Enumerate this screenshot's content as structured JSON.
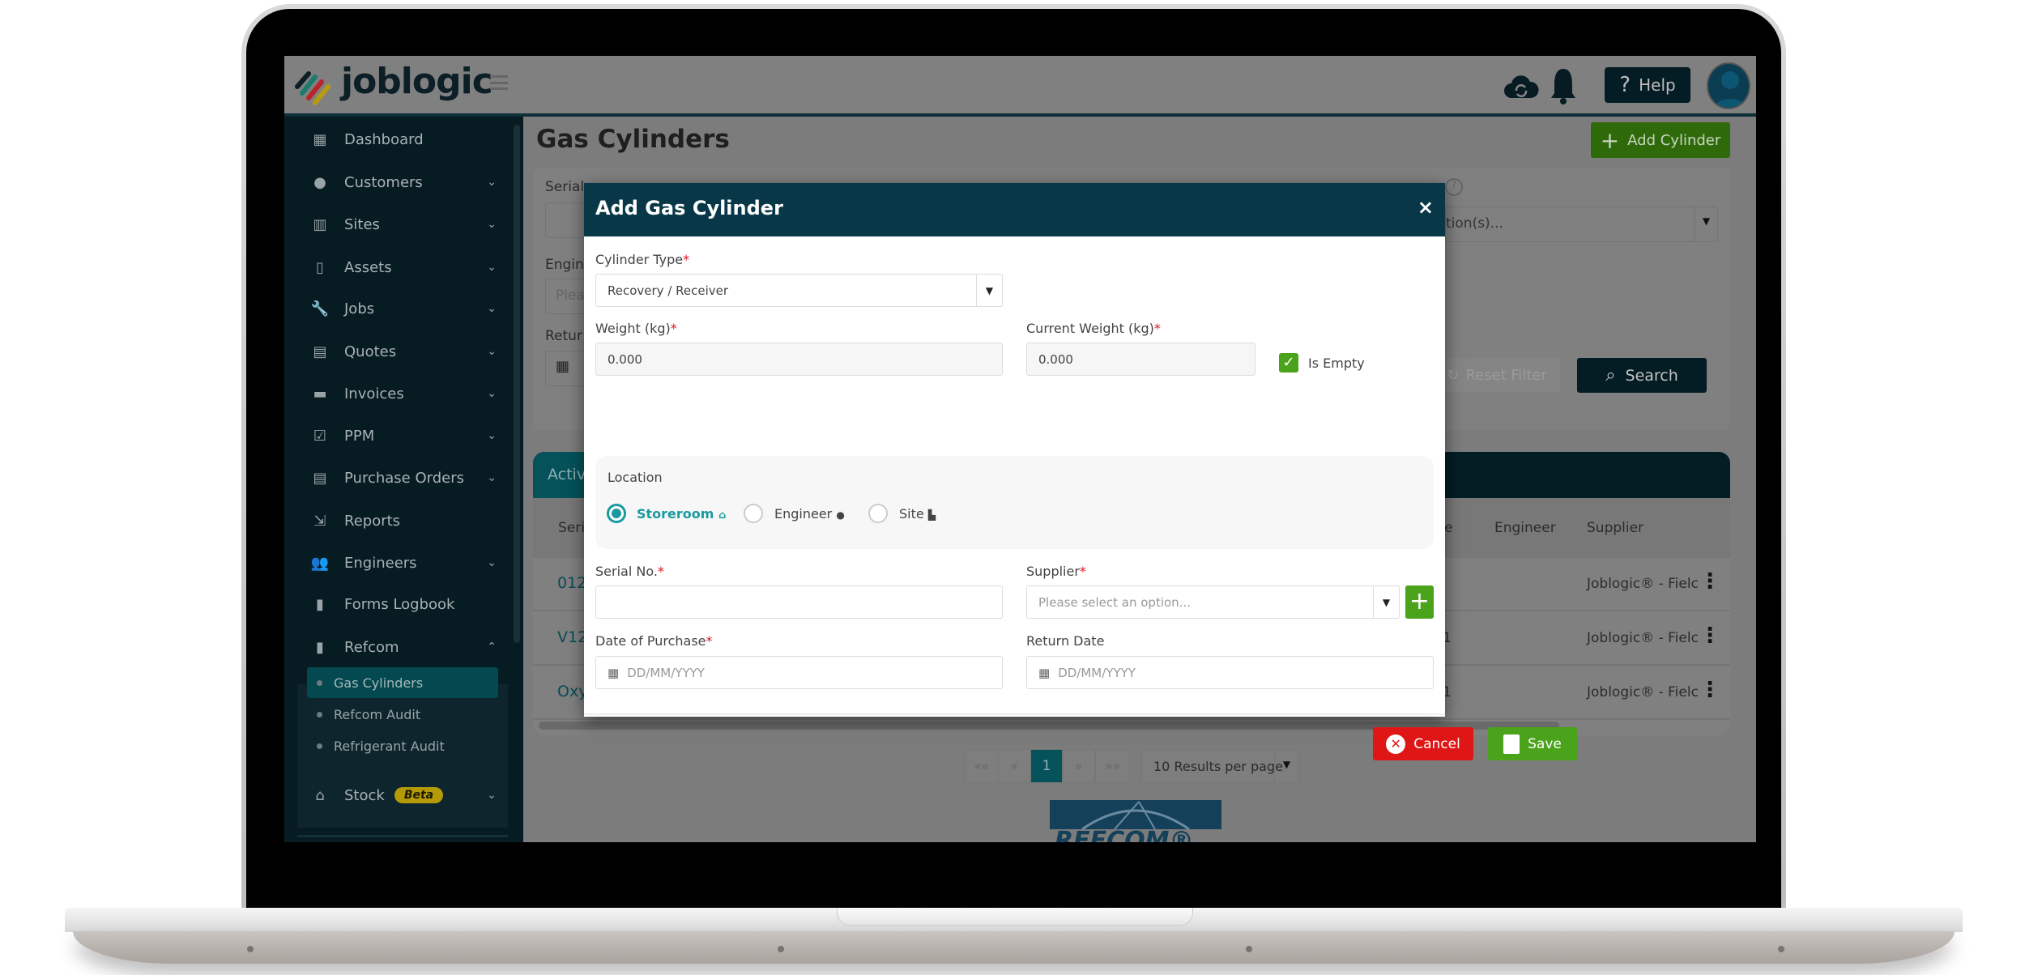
{
  "colors": {
    "brand_teal": "#083848",
    "accent_green": "#4aa31a",
    "danger_red": "#e01616",
    "radio_teal": "#1a9aa0",
    "sidebar": "#061b22"
  },
  "header": {
    "logo": "joblogic",
    "help_label": "Help",
    "icons": [
      "cloud-sync-icon",
      "bell-icon",
      "help-icon",
      "avatar"
    ]
  },
  "sidebar": {
    "items": [
      {
        "label": "Dashboard",
        "icon": "dashboard-icon",
        "glyph": "▦"
      },
      {
        "label": "Customers",
        "icon": "user-icon",
        "glyph": "●",
        "chevron": "⌄"
      },
      {
        "label": "Sites",
        "icon": "building-icon",
        "glyph": "▥",
        "chevron": "⌄"
      },
      {
        "label": "Assets",
        "icon": "asset-icon",
        "glyph": "▯",
        "chevron": "⌄"
      },
      {
        "label": "Jobs",
        "icon": "wrench-icon",
        "glyph": "🔧",
        "chevron": "⌄"
      },
      {
        "label": "Quotes",
        "icon": "clipboard-icon",
        "glyph": "▤",
        "chevron": "⌄"
      },
      {
        "label": "Invoices",
        "icon": "invoice-icon",
        "glyph": "▬",
        "chevron": "⌄"
      },
      {
        "label": "PPM",
        "icon": "calendar-check-icon",
        "glyph": "☑",
        "chevron": "⌄"
      },
      {
        "label": "Purchase Orders",
        "icon": "document-icon",
        "glyph": "▤",
        "chevron": "⌄"
      },
      {
        "label": "Reports",
        "icon": "export-icon",
        "glyph": "⇲"
      },
      {
        "label": "Engineers",
        "icon": "users-icon",
        "glyph": "👥",
        "chevron": "⌄"
      },
      {
        "label": "Forms Logbook",
        "icon": "book-icon",
        "glyph": "▮"
      },
      {
        "label": "Refcom",
        "icon": "cylinder-icon",
        "glyph": "▮",
        "chevron": "⌃"
      }
    ],
    "refcom_sub": [
      "Gas Cylinders",
      "Refcom Audit",
      "Refrigerant Audit"
    ],
    "active_sub": "Gas Cylinders",
    "stock": {
      "label": "Stock",
      "badge": "Beta",
      "icon": "warehouse-icon",
      "glyph": "⌂",
      "chevron": "⌄"
    }
  },
  "page": {
    "title": "Gas Cylinders",
    "add_button": "Add Cylinder",
    "filters": {
      "serial_label": "Serial",
      "engineer_label": "Engine",
      "engineer_placeholder": "Plea",
      "return_label": "Retur",
      "location_placeholder": "tion(s)...",
      "reset_label": "Reset Filter",
      "search_label": "Search"
    },
    "table": {
      "tab": "Activ",
      "headers": [
        "Seri",
        "e",
        "Engineer",
        "Supplier"
      ],
      "rows": [
        {
          "serial": "012",
          "col": "",
          "supplier": "Joblogic® - Fielc"
        },
        {
          "serial": "V12",
          "col": "1",
          "supplier": "Joblogic® - Fielc"
        },
        {
          "serial": "Oxy",
          "col": "1",
          "supplier": "Joblogic® - Fielc"
        }
      ]
    },
    "pagination": {
      "first": "««",
      "prev": "«",
      "current": "1",
      "next": "»",
      "last": "»»",
      "per_page": "10 Results per page"
    },
    "footer_logo": "REFCOM®"
  },
  "modal": {
    "title": "Add Gas Cylinder",
    "close": "×",
    "cylinder_type": {
      "label": "Cylinder Type",
      "value": "Recovery / Receiver"
    },
    "weight": {
      "label": "Weight (kg)",
      "value": "0.000"
    },
    "current_weight": {
      "label": "Current Weight (kg)",
      "value": "0.000"
    },
    "is_empty": {
      "label": "Is Empty",
      "checked": true
    },
    "location": {
      "label": "Location",
      "options": [
        "Storeroom",
        "Engineer",
        "Site"
      ],
      "selected": "Storeroom"
    },
    "serial": {
      "label": "Serial No.",
      "value": ""
    },
    "supplier": {
      "label": "Supplier",
      "placeholder": "Please select an option..."
    },
    "date_purchase": {
      "label": "Date of Purchase",
      "placeholder": "DD/MM/YYYY"
    },
    "return_date": {
      "label": "Return Date",
      "placeholder": "DD/MM/YYYY"
    },
    "required_mark": "*",
    "cancel": "Cancel",
    "save": "Save"
  }
}
